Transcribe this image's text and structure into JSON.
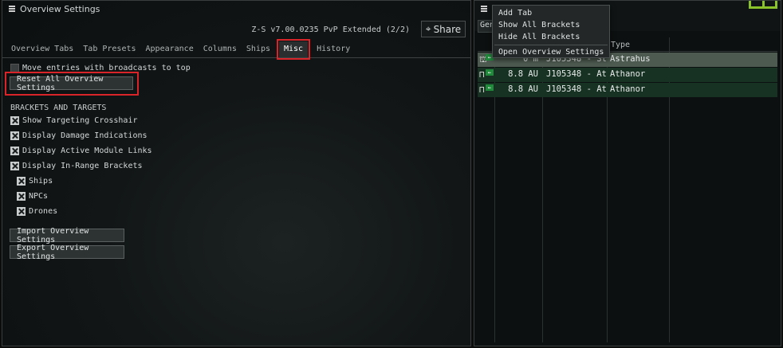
{
  "settings_window": {
    "title": "Overview Settings",
    "preset_name": "Z-S v7.00.0235 PvP Extended (2/2)",
    "share_label": "Share",
    "tabs": [
      "Overview Tabs",
      "Tab Presets",
      "Appearance",
      "Columns",
      "Ships",
      "Misc",
      "History"
    ],
    "active_tab": "Misc",
    "move_broadcasts_label": "Move entries with broadcasts to top",
    "reset_button": "Reset All Overview Settings",
    "brackets_heading": "BRACKETS AND TARGETS",
    "options": [
      {
        "label": "Show Targeting Crosshair",
        "checked": true
      },
      {
        "label": "Display Damage Indications",
        "checked": true
      },
      {
        "label": "Display Active Module Links",
        "checked": true
      },
      {
        "label": "Display In-Range Brackets",
        "checked": true
      }
    ],
    "sub_options": [
      {
        "label": "Ships",
        "checked": true
      },
      {
        "label": "NPCs",
        "checked": true
      },
      {
        "label": "Drones",
        "checked": true
      }
    ],
    "import_button": "Import Overview Settings",
    "export_button": "Export Overview Settings"
  },
  "overview_window": {
    "tab_label": "Gen",
    "columns": {
      "type": "Type"
    },
    "rows": [
      {
        "distance": "0 m",
        "name": "J105348 - St",
        "type": "Astrahus"
      },
      {
        "distance": "8.8 AU",
        "name": "J105348 - At",
        "type": "Athanor"
      },
      {
        "distance": "8.8 AU",
        "name": "J105348 - At",
        "type": "Athanor"
      }
    ]
  },
  "context_menu": {
    "items": [
      "Add Tab",
      "Show All Brackets",
      "Hide All Brackets",
      "Open Overview Settings"
    ]
  },
  "colors": {
    "highlight": "#d9242a",
    "accent_green": "#8ac22a"
  }
}
